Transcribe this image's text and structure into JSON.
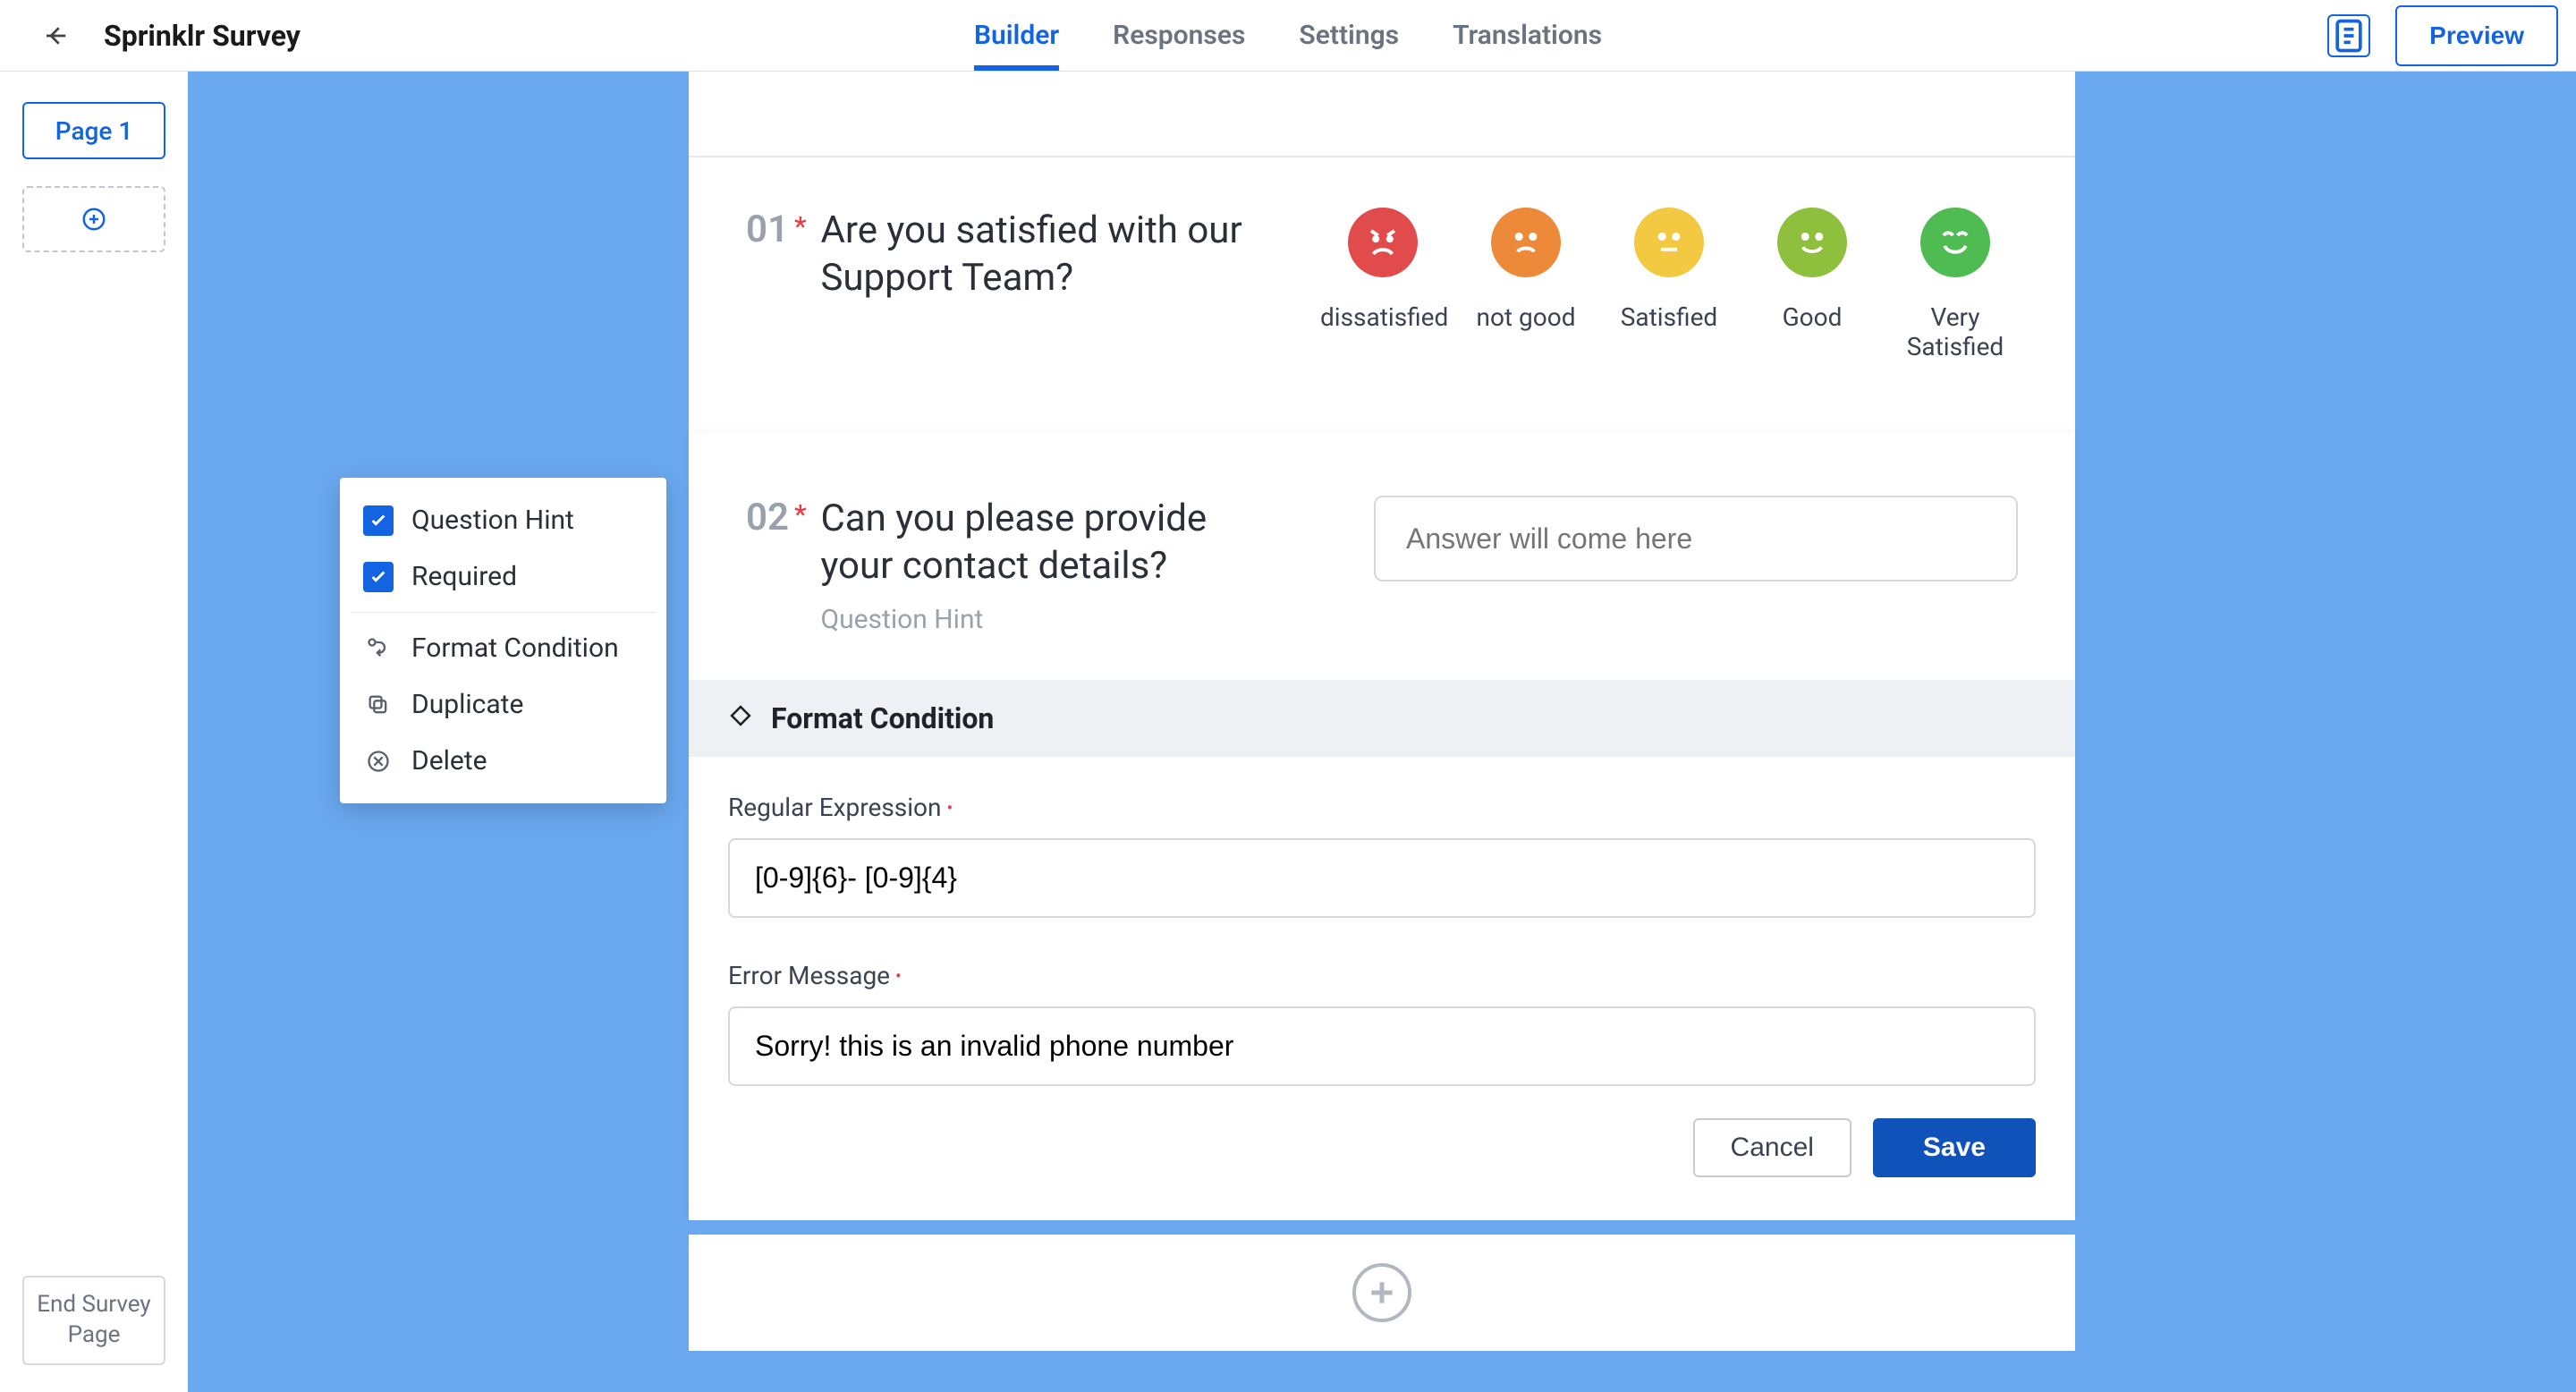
{
  "header": {
    "title": "Sprinklr Survey",
    "tabs": [
      "Builder",
      "Responses",
      "Settings",
      "Translations"
    ],
    "active_tab_index": 0,
    "preview_label": "Preview"
  },
  "sidebar": {
    "page_label": "Page 1",
    "end_survey_label": "End Survey Page"
  },
  "context_menu": {
    "question_hint": {
      "label": "Question Hint",
      "checked": true
    },
    "required": {
      "label": "Required",
      "checked": true
    },
    "format_condition": "Format Condition",
    "duplicate": "Duplicate",
    "delete": "Delete"
  },
  "q1": {
    "number": "01",
    "text": "Are you satisfied with our Support Team?",
    "options": [
      {
        "label": "dissatisfied",
        "tone": "red"
      },
      {
        "label": "not good",
        "tone": "orange"
      },
      {
        "label": "Satisfied",
        "tone": "yellow"
      },
      {
        "label": "Good",
        "tone": "olive"
      },
      {
        "label": "Very Satisfied",
        "tone": "green"
      }
    ]
  },
  "q2": {
    "number": "02",
    "text": "Can you please provide your contact details?",
    "hint": "Question Hint",
    "placeholder": "Answer will come here"
  },
  "format_condition": {
    "title": "Format Condition",
    "regex_label": "Regular Expression",
    "regex_value": "[0-9]{6}- [0-9]{4}",
    "error_label": "Error Message",
    "error_value": "Sorry! this is an invalid phone number",
    "cancel_label": "Cancel",
    "save_label": "Save"
  }
}
